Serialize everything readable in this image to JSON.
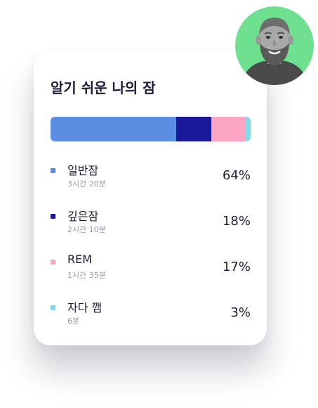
{
  "card": {
    "title": "알기 쉬운 나의 잠"
  },
  "colors": {
    "light_sleep": "#5b8de3",
    "deep_sleep": "#19199a",
    "rem_sleep": "#fca5c3",
    "awake": "#86d8e6",
    "avatar_bg": "#6fe08f"
  },
  "stages": [
    {
      "name": "일반잠",
      "duration": "3시간 20분",
      "percent_label": "64%",
      "percent": 64,
      "color": "#5b8de3"
    },
    {
      "name": "깊은잠",
      "duration": "2시간 10분",
      "percent_label": "18%",
      "percent": 18,
      "color": "#19199a"
    },
    {
      "name": "REM",
      "duration": "1시간 35분",
      "percent_label": "17%",
      "percent": 17,
      "color": "#fca5c3"
    },
    {
      "name": "자다 깸",
      "duration": "6분",
      "percent_label": "3%",
      "percent": 3,
      "color": "#86d8e6"
    }
  ],
  "avatar": {
    "icon": "user-avatar-photo"
  }
}
